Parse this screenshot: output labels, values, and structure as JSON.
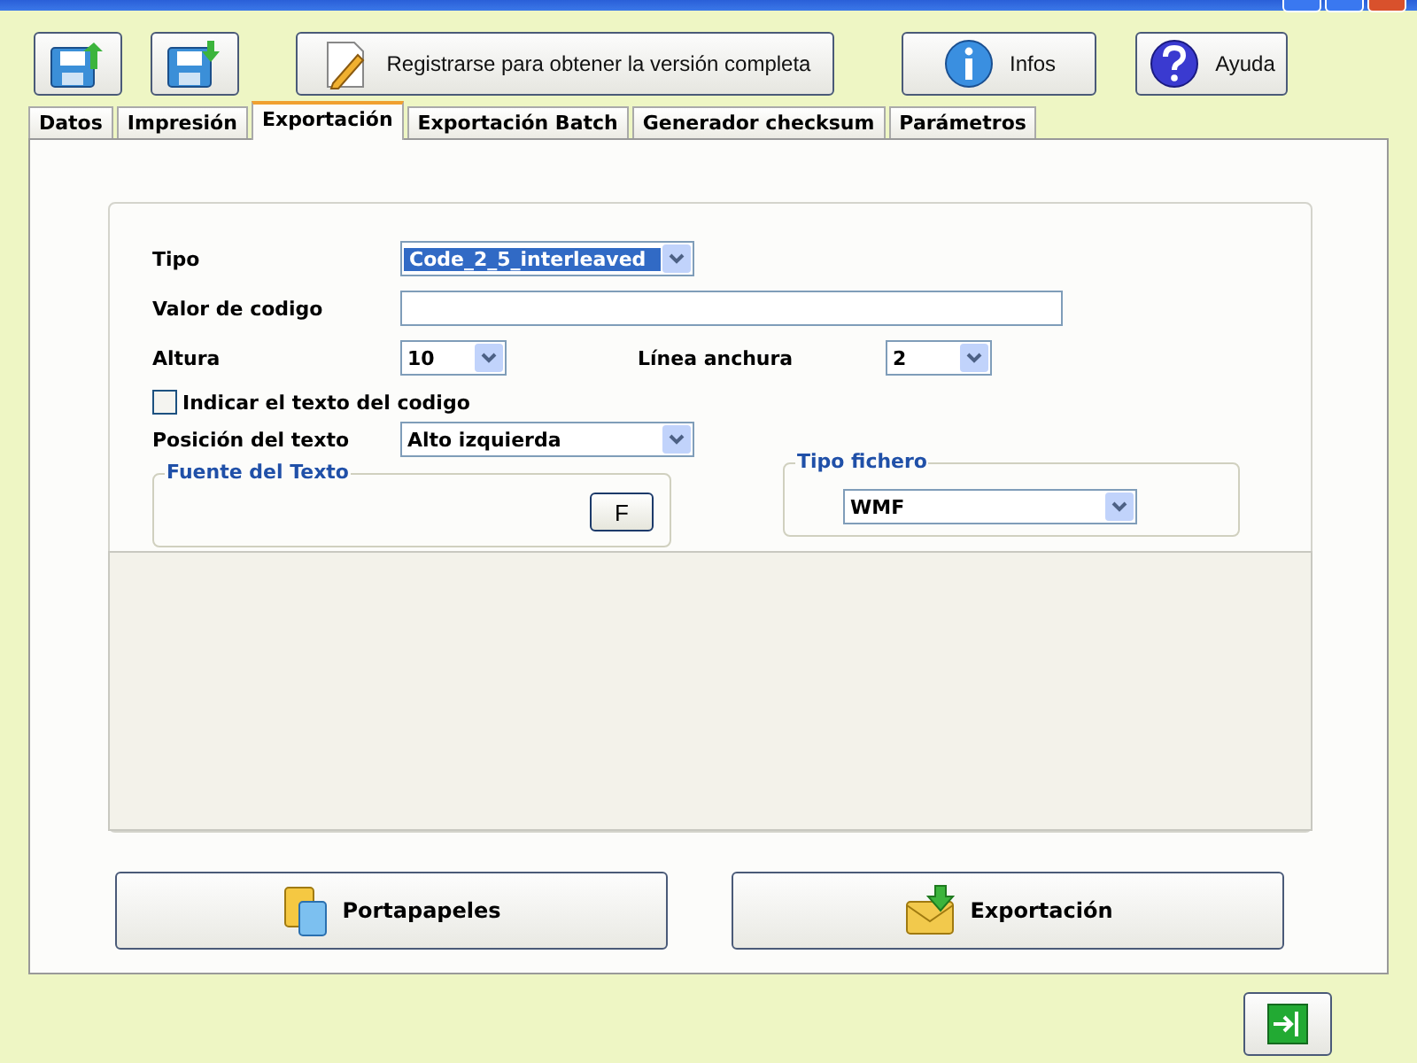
{
  "toolbar": {
    "register_button": "Registrarse para obtener la versión completa",
    "info_button": "Infos",
    "help_button": "Ayuda"
  },
  "tabs": [
    {
      "label": "Datos",
      "selected": false
    },
    {
      "label": "Impresión",
      "selected": false
    },
    {
      "label": "Exportación",
      "selected": true
    },
    {
      "label": "Exportación Batch",
      "selected": false
    },
    {
      "label": "Generador checksum",
      "selected": false
    },
    {
      "label": "Parámetros",
      "selected": false
    }
  ],
  "form": {
    "tipo": {
      "label": "Tipo",
      "value": "Code_2_5_interleaved",
      "focused": true
    },
    "valor": {
      "label": "Valor de codigo"
    },
    "altura": {
      "label": "Altura",
      "value": "10"
    },
    "linea": {
      "label": "Línea anchura",
      "value": "2"
    },
    "show_text": {
      "label": "Indicar el texto del codigo",
      "checked": false
    },
    "posicion": {
      "label": "Posición del texto",
      "value": "Alto izquierda"
    },
    "font_group": {
      "title": "Fuente del Texto",
      "button": "F"
    },
    "file_type": {
      "title": "Tipo fichero",
      "value": "WMF"
    }
  },
  "actions": [
    {
      "label": "Portapapeles",
      "kind": "clipboard"
    },
    {
      "label": "Exportación",
      "kind": "export"
    }
  ]
}
